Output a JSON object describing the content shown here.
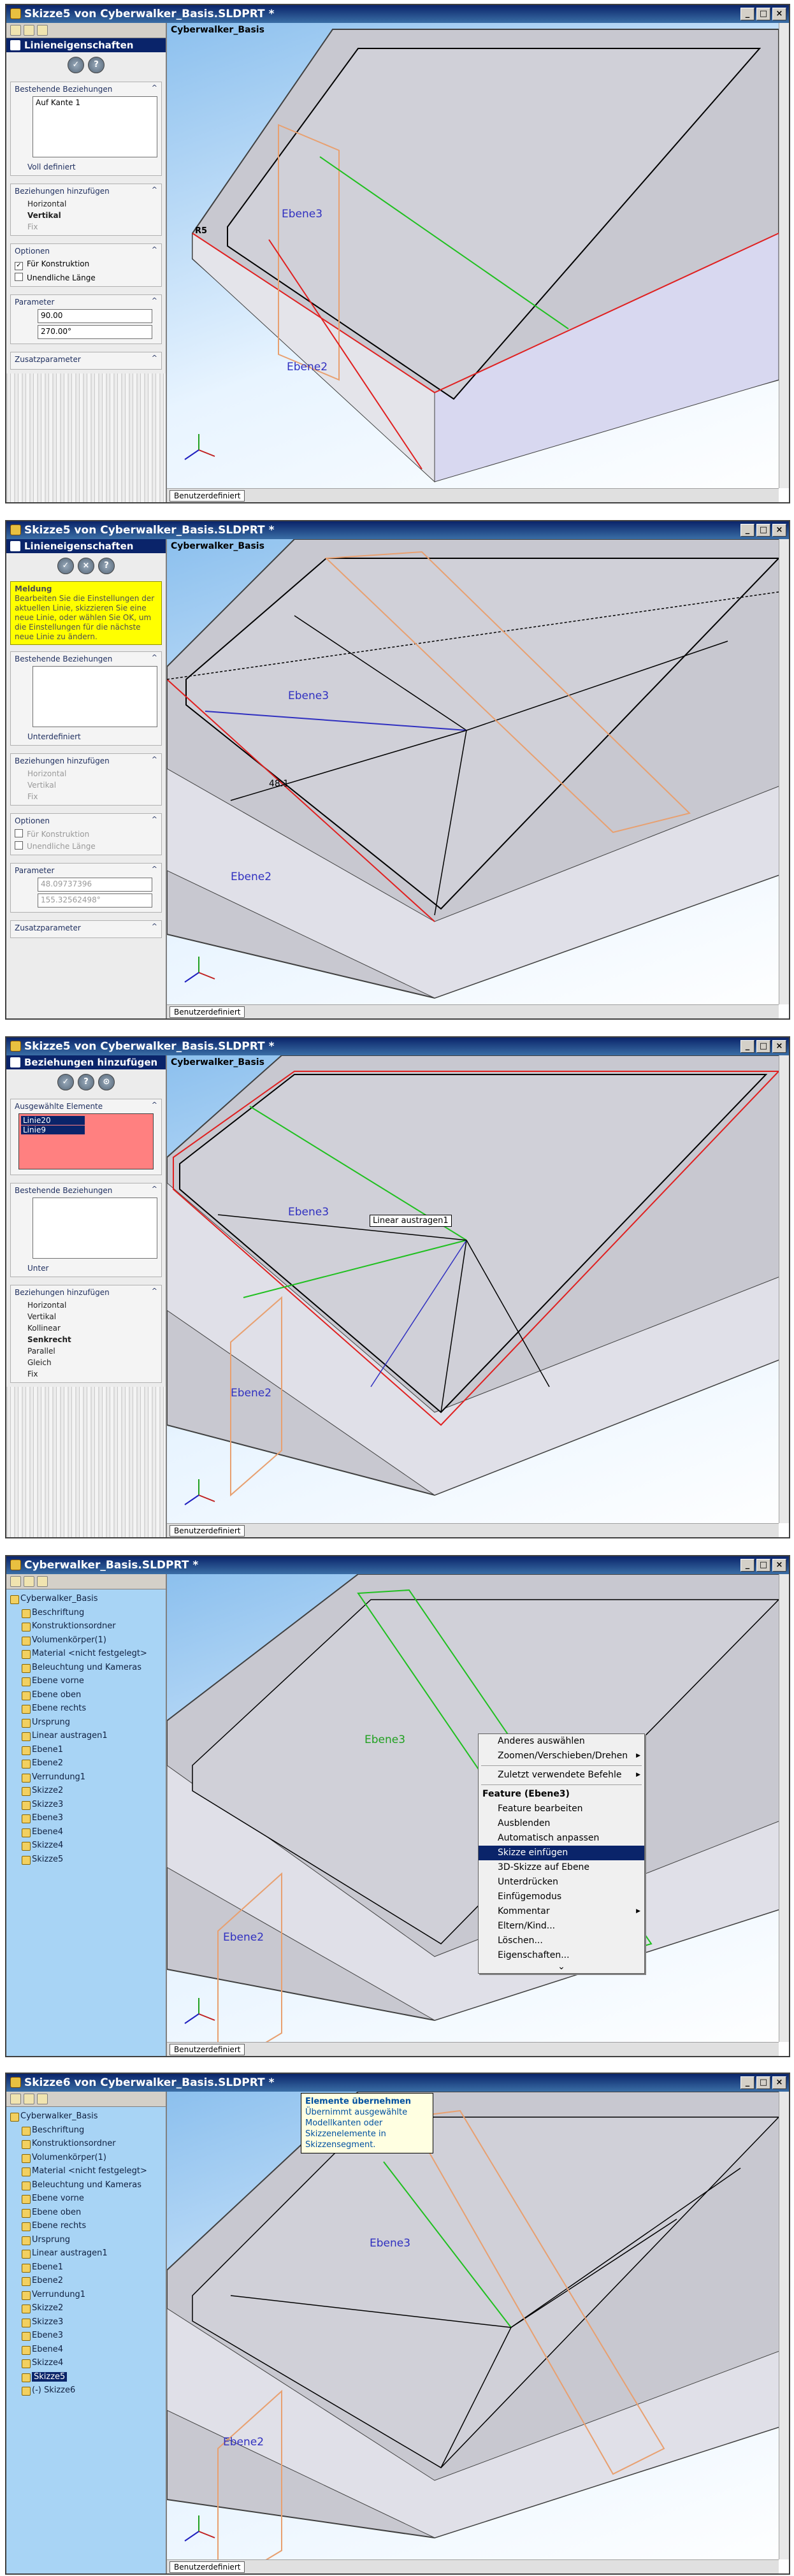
{
  "panel1": {
    "title": "Skizze5 von Cyberwalker_Basis.SLDPRT *",
    "pm_title": "Linieneigenschaften",
    "existing_relations": "Bestehende Beziehungen",
    "relation_item": "Auf Kante 1",
    "status": "Voll definiert",
    "add_relations": "Beziehungen hinzufügen",
    "rel_horizontal": "Horizontal",
    "rel_vertical": "Vertikal",
    "rel_fix": "Fix",
    "options": "Optionen",
    "opt_construction": "Für Konstruktion",
    "opt_infinite": "Unendliche Länge",
    "parameters": "Parameter",
    "param_length": "90.00",
    "param_angle": "270.00°",
    "extra_params": "Zusatzparameter",
    "tree_root": "Cyberwalker_Basis",
    "dim_label": "R5",
    "plane3": "Ebene3",
    "plane2": "Ebene2",
    "scroll_tab": "Benutzerdefiniert"
  },
  "panel2": {
    "title": "Skizze5 von Cyberwalker_Basis.SLDPRT *",
    "pm_title": "Linieneigenschaften",
    "message_title": "Meldung",
    "message": "Bearbeiten Sie die Einstellungen der aktuellen Linie, skizzieren Sie eine neue Linie, oder wählen Sie OK, um die Einstellungen für die nächste neue Linie zu ändern.",
    "existing_relations": "Bestehende Beziehungen",
    "status": "Unterdefiniert",
    "add_relations": "Beziehungen hinzufügen",
    "rel_horizontal": "Horizontal",
    "rel_vertical": "Vertikal",
    "rel_fix": "Fix",
    "options": "Optionen",
    "opt_construction": "Für Konstruktion",
    "opt_infinite": "Unendliche Länge",
    "parameters": "Parameter",
    "param_length": "48.09737396",
    "param_angle": "155.32562498°",
    "extra_params": "Zusatzparameter",
    "tree_root": "Cyberwalker_Basis",
    "dim_label": "48.1",
    "plane3": "Ebene3",
    "plane2": "Ebene2",
    "scroll_tab": "Benutzerdefiniert"
  },
  "panel3": {
    "title": "Skizze5 von Cyberwalker_Basis.SLDPRT *",
    "pm_title": "Beziehungen hinzufügen",
    "selected_entities": "Ausgewählte Elemente",
    "sel1": "Linie20",
    "sel2": "Linie9",
    "existing_relations": "Bestehende Beziehungen",
    "status": "Unter",
    "add_relations": "Beziehungen hinzufügen",
    "rel_horizontal": "Horizontal",
    "rel_vertical": "Vertikal",
    "rel_collinear": "Kollinear",
    "rel_perpendicular": "Senkrecht",
    "rel_parallel": "Parallel",
    "rel_equal": "Gleich",
    "rel_fix": "Fix",
    "tree_root": "Cyberwalker_Basis",
    "callout": "Linear austragen1",
    "plane3": "Ebene3",
    "plane2": "Ebene2",
    "scroll_tab": "Benutzerdefiniert"
  },
  "panel4": {
    "title": "Cyberwalker_Basis.SLDPRT *",
    "tree": [
      "Cyberwalker_Basis",
      "Beschriftung",
      "Konstruktionsordner",
      "Volumenkörper(1)",
      "Material <nicht festgelegt>",
      "Beleuchtung und Kameras",
      "Ebene vorne",
      "Ebene oben",
      "Ebene rechts",
      "Ursprung",
      "Linear austragen1",
      "Ebene1",
      "Ebene2",
      "Verrundung1",
      "Skizze2",
      "Skizze3",
      "Ebene3",
      "Ebene4",
      "Skizze4",
      "Skizze5"
    ],
    "menu": [
      "Anderes auswählen",
      "Zoomen/Verschieben/Drehen",
      "Zuletzt verwendete Befehle",
      "Feature (Ebene3)",
      "Feature bearbeiten",
      "Ausblenden",
      "Automatisch anpassen",
      "Skizze einfügen",
      "3D-Skizze auf Ebene",
      "Unterdrücken",
      "Einfügemodus",
      "Kommentar",
      "Eltern/Kind...",
      "Löschen...",
      "Eigenschaften..."
    ],
    "plane3": "Ebene3",
    "plane2": "Ebene2",
    "scroll_tab": "Benutzerdefiniert"
  },
  "panel5": {
    "title": "Skizze6 von Cyberwalker_Basis.SLDPRT *",
    "tree": [
      "Cyberwalker_Basis",
      "Beschriftung",
      "Konstruktionsordner",
      "Volumenkörper(1)",
      "Material <nicht festgelegt>",
      "Beleuchtung und Kameras",
      "Ebene vorne",
      "Ebene oben",
      "Ebene rechts",
      "Ursprung",
      "Linear austragen1",
      "Ebene1",
      "Ebene2",
      "Verrundung1",
      "Skizze2",
      "Skizze3",
      "Ebene3",
      "Ebene4",
      "Skizze4",
      "Skizze5",
      "(-) Skizze6"
    ],
    "tooltip_title": "Elemente übernehmen",
    "tooltip_text": "Übernimmt ausgewählte Modellkanten oder Skizzenelemente in Skizzensegment.",
    "plane3": "Ebene3",
    "plane2": "Ebene2",
    "scroll_tab": "Benutzerdefiniert"
  },
  "colors": {
    "title_bar": "#0a246a",
    "tree_bg": "#a8d4f5",
    "sketch_red": "#e02020",
    "plane_orange": "#e8a070",
    "sketch_green": "#20c020"
  }
}
